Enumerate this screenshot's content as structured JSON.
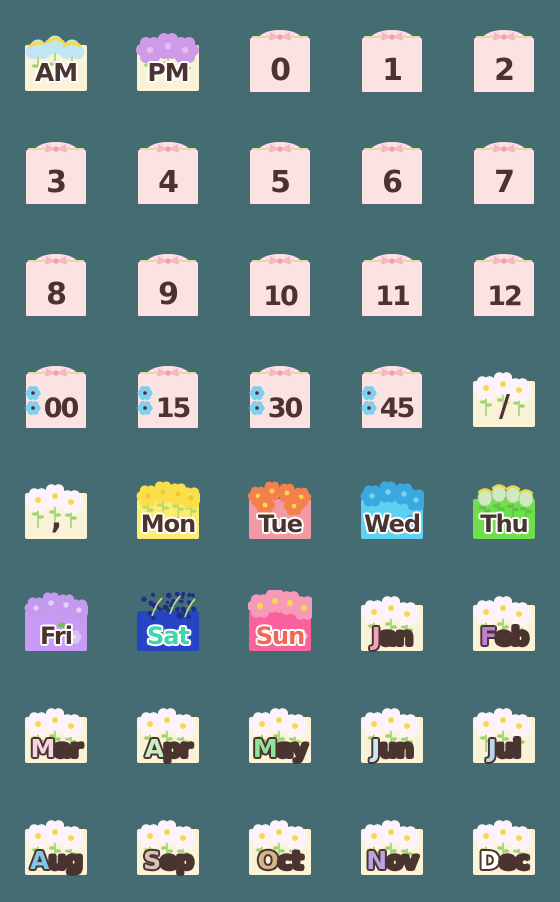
{
  "sheet": {
    "title": "Calendar & Clock Emoji Sticker Sheet",
    "background_color": "#456c73",
    "columns": 5,
    "rows": 8,
    "total_stickers": 40
  },
  "palette": {
    "background": "#456c73",
    "card_pink": "#fbe3e4",
    "card_cream": "#fbf3d8",
    "ink_brown": "#4b3430",
    "bow_pink": "#f7b8c6",
    "flower_blue": "#7fd0ef",
    "flower_white": "#fdf6fb",
    "flower_yellow": "#f7d94b"
  },
  "stickers": [
    {
      "id": 1,
      "label": "AM",
      "kind": "ampm",
      "bg": "#fbf3d8",
      "text_color": "#4b3430",
      "outline": "white",
      "deco": "fluffy-blue-flowers",
      "row": 1,
      "col": 1
    },
    {
      "id": 2,
      "label": "PM",
      "kind": "ampm",
      "bg": "#fbf3d8",
      "text_color": "#4b3430",
      "outline": "white",
      "deco": "violet-flowers",
      "row": 1,
      "col": 2
    },
    {
      "id": 3,
      "label": "0",
      "kind": "hour",
      "bg": "#fbe3e4",
      "text_color": "#4b3430",
      "outline": "none",
      "deco": "pink-bow",
      "row": 1,
      "col": 3
    },
    {
      "id": 4,
      "label": "1",
      "kind": "hour",
      "bg": "#fbe3e4",
      "text_color": "#4b3430",
      "outline": "none",
      "deco": "pink-bow",
      "row": 1,
      "col": 4
    },
    {
      "id": 5,
      "label": "2",
      "kind": "hour",
      "bg": "#fbe3e4",
      "text_color": "#4b3430",
      "outline": "none",
      "deco": "pink-bow",
      "row": 1,
      "col": 5
    },
    {
      "id": 6,
      "label": "3",
      "kind": "hour",
      "bg": "#fbe3e4",
      "text_color": "#4b3430",
      "outline": "none",
      "deco": "pink-bow",
      "row": 2,
      "col": 1
    },
    {
      "id": 7,
      "label": "4",
      "kind": "hour",
      "bg": "#fbe3e4",
      "text_color": "#4b3430",
      "outline": "none",
      "deco": "pink-bow",
      "row": 2,
      "col": 2
    },
    {
      "id": 8,
      "label": "5",
      "kind": "hour",
      "bg": "#fbe3e4",
      "text_color": "#4b3430",
      "outline": "none",
      "deco": "pink-bow",
      "row": 2,
      "col": 3
    },
    {
      "id": 9,
      "label": "6",
      "kind": "hour",
      "bg": "#fbe3e4",
      "text_color": "#4b3430",
      "outline": "none",
      "deco": "pink-bow",
      "row": 2,
      "col": 4
    },
    {
      "id": 10,
      "label": "7",
      "kind": "hour",
      "bg": "#fbe3e4",
      "text_color": "#4b3430",
      "outline": "none",
      "deco": "pink-bow",
      "row": 2,
      "col": 5
    },
    {
      "id": 11,
      "label": "8",
      "kind": "hour",
      "bg": "#fbe3e4",
      "text_color": "#4b3430",
      "outline": "none",
      "deco": "pink-bow",
      "row": 3,
      "col": 1
    },
    {
      "id": 12,
      "label": "9",
      "kind": "hour",
      "bg": "#fbe3e4",
      "text_color": "#4b3430",
      "outline": "none",
      "deco": "pink-bow",
      "row": 3,
      "col": 2
    },
    {
      "id": 13,
      "label": "10",
      "kind": "hour",
      "bg": "#fbe3e4",
      "text_color": "#4b3430",
      "outline": "none",
      "deco": "pink-bow",
      "row": 3,
      "col": 3
    },
    {
      "id": 14,
      "label": "11",
      "kind": "hour",
      "bg": "#fbe3e4",
      "text_color": "#4b3430",
      "outline": "none",
      "deco": "pink-bow",
      "row": 3,
      "col": 4
    },
    {
      "id": 15,
      "label": "12",
      "kind": "hour",
      "bg": "#fbe3e4",
      "text_color": "#4b3430",
      "outline": "none",
      "deco": "pink-bow",
      "row": 3,
      "col": 5
    },
    {
      "id": 16,
      "label": "00",
      "kind": "minute",
      "bg": "#fbe3e4",
      "text_color": "#4b3430",
      "outline": "none",
      "deco": "pink-bow+blue-daisies",
      "row": 4,
      "col": 1
    },
    {
      "id": 17,
      "label": "15",
      "kind": "minute",
      "bg": "#fbe3e4",
      "text_color": "#4b3430",
      "outline": "none",
      "deco": "pink-bow+blue-daisies",
      "row": 4,
      "col": 2
    },
    {
      "id": 18,
      "label": "30",
      "kind": "minute",
      "bg": "#fbe3e4",
      "text_color": "#4b3430",
      "outline": "none",
      "deco": "pink-bow+blue-daisies",
      "row": 4,
      "col": 3
    },
    {
      "id": 19,
      "label": "45",
      "kind": "minute",
      "bg": "#fbe3e4",
      "text_color": "#4b3430",
      "outline": "none",
      "deco": "pink-bow+blue-daisies",
      "row": 4,
      "col": 4
    },
    {
      "id": 20,
      "label": "/",
      "kind": "punct",
      "bg": "#fbf3d8",
      "text_color": "#4b3430",
      "outline": "none",
      "deco": "white-daisies",
      "row": 4,
      "col": 5
    },
    {
      "id": 21,
      "label": ",",
      "kind": "punct",
      "bg": "#fbf3d8",
      "text_color": "#4b3430",
      "outline": "none",
      "deco": "white-daisies",
      "row": 5,
      "col": 1
    },
    {
      "id": 22,
      "label": "Mon",
      "kind": "day",
      "bg": "#fdec72",
      "text_color": "#4b3430",
      "outline": "white",
      "deco": "yellow-rapeseed",
      "row": 5,
      "col": 2
    },
    {
      "id": 23,
      "label": "Tue",
      "kind": "day",
      "bg": "#f29aa3",
      "text_color": "#4b3430",
      "outline": "white",
      "deco": "orange-cosmos",
      "row": 5,
      "col": 3
    },
    {
      "id": 24,
      "label": "Wed",
      "kind": "day",
      "bg": "#5fd0f0",
      "text_color": "#4b3430",
      "outline": "white",
      "deco": "blue-flowers",
      "row": 5,
      "col": 4
    },
    {
      "id": 25,
      "label": "Thu",
      "kind": "day",
      "bg": "#6ede4a",
      "text_color": "#4b3430",
      "outline": "white",
      "deco": "pale-green-tulips",
      "row": 5,
      "col": 5
    },
    {
      "id": 26,
      "label": "Fri",
      "kind": "day",
      "bg": "#c79bf5",
      "text_color": "#4b3430",
      "outline": "white",
      "deco": "lilac-flowers",
      "row": 6,
      "col": 1
    },
    {
      "id": 27,
      "label": "Sat",
      "kind": "day",
      "bg": "#2644c4",
      "text_color": "#3cd6ac",
      "outline": "white",
      "deco": "navy-wildflowers",
      "row": 6,
      "col": 2
    },
    {
      "id": 28,
      "label": "Sun",
      "kind": "day",
      "bg": "#f9629a",
      "text_color": "#f4664f",
      "outline": "white",
      "deco": "pink-blossoms",
      "row": 6,
      "col": 3
    },
    {
      "id": 29,
      "label": "Jan",
      "kind": "month",
      "bg": "#fbf3d8",
      "initial_color": "#f0a3bb",
      "text_color": "#4b3430",
      "outline": "dark",
      "deco": "white-daisies",
      "row": 6,
      "col": 4
    },
    {
      "id": 30,
      "label": "Feb",
      "kind": "month",
      "bg": "#fbf3d8",
      "initial_color": "#c07fd4",
      "text_color": "#4b3430",
      "outline": "dark",
      "deco": "white-daisies",
      "row": 6,
      "col": 5
    },
    {
      "id": 31,
      "label": "Mar",
      "kind": "month",
      "bg": "#fbf3d8",
      "initial_color": "#f6d4e2",
      "text_color": "#4b3430",
      "outline": "dark",
      "deco": "white-daisies",
      "row": 7,
      "col": 1
    },
    {
      "id": 32,
      "label": "Apr",
      "kind": "month",
      "bg": "#fbf3d8",
      "initial_color": "#c9eec3",
      "text_color": "#4b3430",
      "outline": "dark",
      "deco": "white-daisies",
      "row": 7,
      "col": 2
    },
    {
      "id": 33,
      "label": "May",
      "kind": "month",
      "bg": "#fbf3d8",
      "initial_color": "#93e29a",
      "text_color": "#4b3430",
      "outline": "dark",
      "deco": "white-daisies",
      "row": 7,
      "col": 3
    },
    {
      "id": 34,
      "label": "Jun",
      "kind": "month",
      "bg": "#fbf3d8",
      "initial_color": "#c7e9f7",
      "text_color": "#4b3430",
      "outline": "dark",
      "deco": "white-daisies",
      "row": 7,
      "col": 4
    },
    {
      "id": 35,
      "label": "Jul",
      "kind": "month",
      "bg": "#fbf3d8",
      "initial_color": "#b9d4ef",
      "text_color": "#4b3430",
      "outline": "dark",
      "deco": "white-daisies",
      "row": 7,
      "col": 5
    },
    {
      "id": 36,
      "label": "Aug",
      "kind": "month",
      "bg": "#fbf3d8",
      "initial_color": "#7ec8e8",
      "text_color": "#4b3430",
      "outline": "dark",
      "deco": "white-daisies",
      "row": 8,
      "col": 1
    },
    {
      "id": 37,
      "label": "Sep",
      "kind": "month",
      "bg": "#fbf3d8",
      "initial_color": "#d7c3b3",
      "text_color": "#4b3430",
      "outline": "dark",
      "deco": "white-daisies",
      "row": 8,
      "col": 2
    },
    {
      "id": 38,
      "label": "Oct",
      "kind": "month",
      "bg": "#fbf3d8",
      "initial_color": "#d6b489",
      "text_color": "#4b3430",
      "outline": "dark",
      "deco": "white-daisies",
      "row": 8,
      "col": 3
    },
    {
      "id": 39,
      "label": "Nov",
      "kind": "month",
      "bg": "#fbf3d8",
      "initial_color": "#b9a3e0",
      "text_color": "#4b3430",
      "outline": "dark",
      "deco": "white-daisies",
      "row": 8,
      "col": 4
    },
    {
      "id": 40,
      "label": "Dec",
      "kind": "month",
      "bg": "#fbf3d8",
      "initial_color": "#ffffff",
      "text_color": "#4b3430",
      "outline": "dark",
      "deco": "white-daisies",
      "row": 8,
      "col": 5
    }
  ]
}
